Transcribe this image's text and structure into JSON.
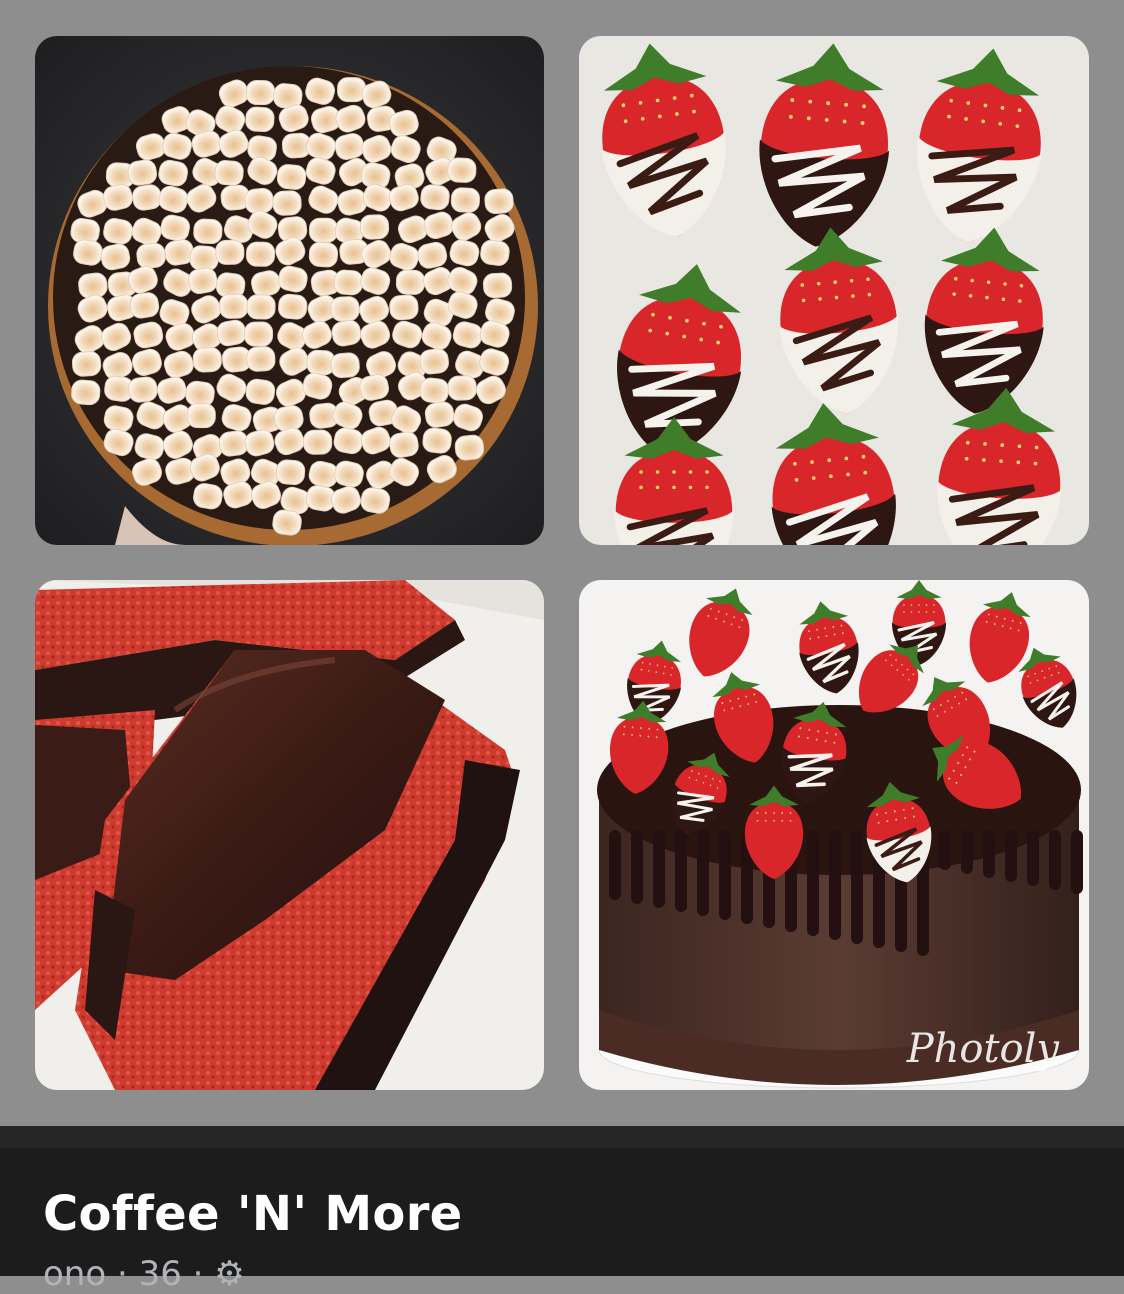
{
  "post": {
    "title": "Coffee 'N' More",
    "meta_fragment": "ono · 36 · ⚙"
  },
  "photos": [
    {
      "name": "smores-pie-photo",
      "subject": "pie topped with toasted marshmallows"
    },
    {
      "name": "chocolate-strawberries-photo",
      "subject": "chocolate-dipped strawberries with drizzle"
    },
    {
      "name": "red-velvet-cheesecake-photo",
      "subject": "red velvet cheesecake slices with ganache"
    },
    {
      "name": "strawberry-chocolate-cake-photo",
      "subject": "chocolate drip cake topped with strawberries",
      "watermark": "Photoly"
    }
  ],
  "colors": {
    "collage_background": "#8e8e8f",
    "footer_background": "#1c1c1d",
    "title_text": "#ffffff",
    "meta_text": "#b0b3b8"
  }
}
